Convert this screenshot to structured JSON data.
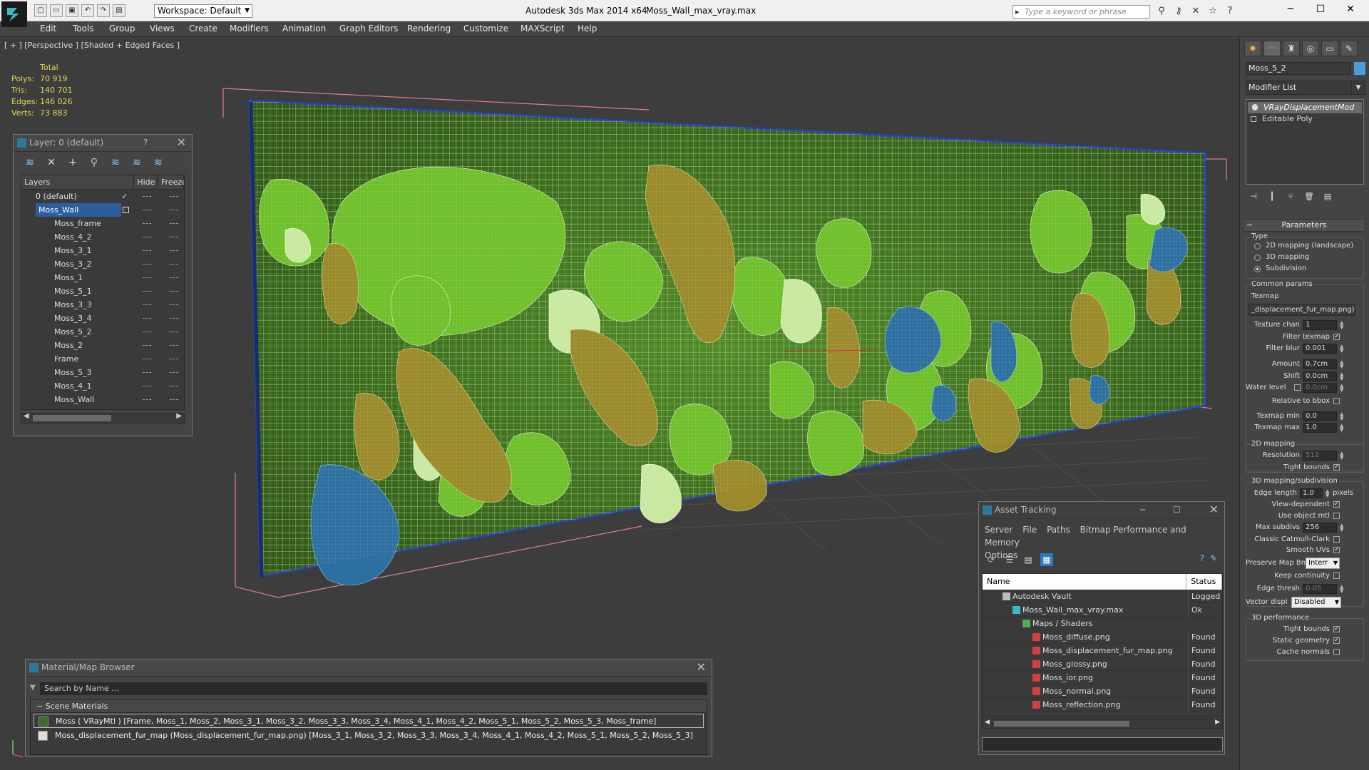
{
  "app": {
    "title": "Autodesk 3ds Max  2014 x64",
    "file": "Moss_Wall_max_vray.max",
    "workspace": "Workspace: Default",
    "search_placeholder": "Type a keyword or phrase"
  },
  "menu": [
    "Edit",
    "Tools",
    "Group",
    "Views",
    "Create",
    "Modifiers",
    "Animation",
    "Graph Editors",
    "Rendering",
    "Customize",
    "MAXScript",
    "Help"
  ],
  "viewport": {
    "label": "[ + ] [Perspective ] [Shaded + Edged Faces ]",
    "stats": {
      "header": "Total",
      "rows": [
        {
          "k": "Polys:",
          "v": "70 919"
        },
        {
          "k": "Tris:",
          "v": "140 701"
        },
        {
          "k": "Edges:",
          "v": "146 026"
        },
        {
          "k": "Verts:",
          "v": "73 883"
        }
      ]
    }
  },
  "layer_window": {
    "title": "Layer: 0 (default)",
    "help": "?",
    "columns": [
      "Layers",
      "Hide",
      "Freeze"
    ],
    "rows": [
      "0 (default)",
      "Moss_Wall",
      "Moss_frame",
      "Moss_4_2",
      "Moss_3_1",
      "Moss_3_2",
      "Moss_1",
      "Moss_5_1",
      "Moss_3_3",
      "Moss_3_4",
      "Moss_5_2",
      "Moss_2",
      "Frame",
      "Moss_5_3",
      "Moss_4_1",
      "Moss_Wall"
    ]
  },
  "material_browser": {
    "title": "Material/Map Browser",
    "search_placeholder": "Search by Name ...",
    "section": "Scene Materials",
    "items": [
      "Moss ( VRayMtl ) [Frame, Moss_1, Moss_2, Moss_3_1, Moss_3_2, Moss_3_3, Moss_3_4, Moss_4_1, Moss_4_2, Moss_5_1, Moss_5_2, Moss_5_3, Moss_frame]",
      "Moss_displacement_fur_map (Moss_displacement_fur_map.png) [Moss_3_1, Moss_3_2, Moss_3_3, Moss_3_4, Moss_4_1, Moss_4_2, Moss_5_1, Moss_5_2, Moss_5_3]"
    ]
  },
  "asset_tracking": {
    "title": "Asset Tracking",
    "menu": [
      "Server",
      "File",
      "Paths",
      "Bitmap Performance and Memory",
      "Options"
    ],
    "columns": [
      "Name",
      "Status"
    ],
    "rows": [
      {
        "name": "Autodesk Vault",
        "status": "Logged C",
        "indent": 0
      },
      {
        "name": "Moss_Wall_max_vray.max",
        "status": "Ok",
        "indent": 1
      },
      {
        "name": "Maps / Shaders",
        "status": "",
        "indent": 2
      },
      {
        "name": "Moss_diffuse.png",
        "status": "Found",
        "indent": 3
      },
      {
        "name": "Moss_displacement_fur_map.png",
        "status": "Found",
        "indent": 3
      },
      {
        "name": "Moss_glossy.png",
        "status": "Found",
        "indent": 3
      },
      {
        "name": "Moss_ior.png",
        "status": "Found",
        "indent": 3
      },
      {
        "name": "Moss_normal.png",
        "status": "Found",
        "indent": 3
      },
      {
        "name": "Moss_reflection.png",
        "status": "Found",
        "indent": 3
      }
    ]
  },
  "command_panel": {
    "object_name": "Moss_5_2",
    "modifier_list": "Modifier List",
    "stack": [
      "VRayDisplacementMod",
      "Editable Poly"
    ],
    "parameters": "Parameters",
    "type_group": "Type",
    "type_options": [
      "2D mapping (landscape)",
      "3D mapping",
      "Subdivision"
    ],
    "common_group": "Common params",
    "texmap_label": "Texmap",
    "texmap_value": "_displacement_fur_map.png)",
    "texture_chan_label": "Texture chan",
    "texture_chan": "1",
    "filter_texmap": "Filter texmap",
    "filter_blur_label": "Filter blur",
    "filter_blur": "0.001",
    "amount_label": "Amount",
    "amount": "0.7cm",
    "shift_label": "Shift",
    "shift": "0.0cm",
    "water_label": "Water level",
    "water": "0.0cm",
    "relative_bbox": "Relative to bbox",
    "texmap_min_label": "Texmap min",
    "texmap_min": "0.0",
    "texmap_max_label": "Texmap max",
    "texmap_max": "1.0",
    "mapping2d_group": "2D mapping",
    "resolution_label": "Resolution",
    "resolution": "512",
    "tight_bounds": "Tight bounds",
    "mapping3d_group": "3D mapping/subdivision",
    "edge_length_label": "Edge length",
    "edge_length": "1.0",
    "pixels": "pixels",
    "view_dependent": "View-dependent",
    "use_object_mtl": "Use object mtl",
    "max_subdivs_label": "Max subdivs",
    "max_subdivs": "256",
    "classic_catmull": "Classic Catmull-Clark",
    "smooth_uvs": "Smooth UVs",
    "preserve_label": "Preserve Map Bnd",
    "preserve_value": "Interr",
    "keep_continuity": "Keep continuity",
    "edge_thresh_label": "Edge thresh",
    "edge_thresh": "0.05",
    "vector_label": "Vector displ",
    "vector_value": "Disabled",
    "perf_group": "3D performance",
    "perf_tight": "Tight bounds",
    "static_geometry": "Static geometry",
    "cache_normals": "Cache normals"
  }
}
